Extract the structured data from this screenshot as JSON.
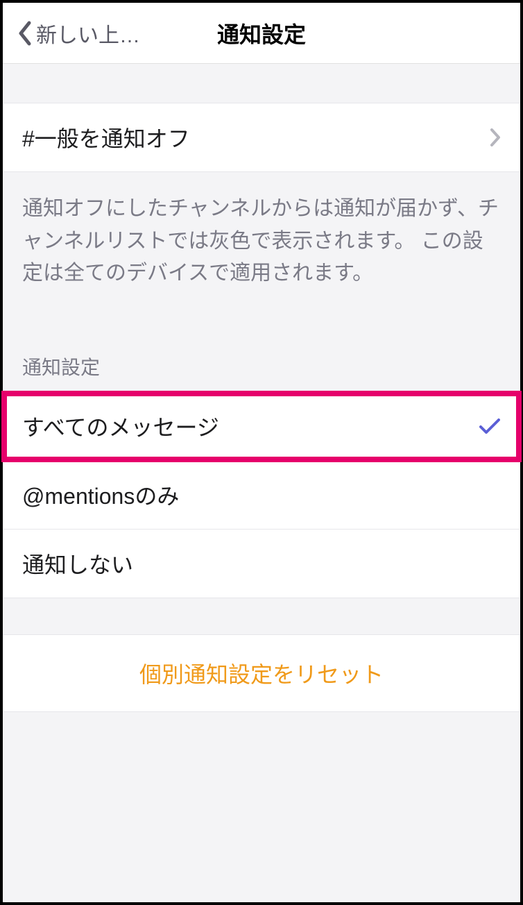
{
  "header": {
    "back_label": "新しい上…",
    "title": "通知設定"
  },
  "mute": {
    "label": "#一般を通知オフ"
  },
  "description": "通知オフにしたチャンネルからは通知が届かず、チャンネルリストでは灰色で表示されます。 この設定は全てのデバイスで適用されます。",
  "section_title": "通知設定",
  "options": {
    "all": "すべてのメッセージ",
    "mentions": "@mentionsのみ",
    "none": "通知しない"
  },
  "reset_label": "個別通知設定をリセット"
}
